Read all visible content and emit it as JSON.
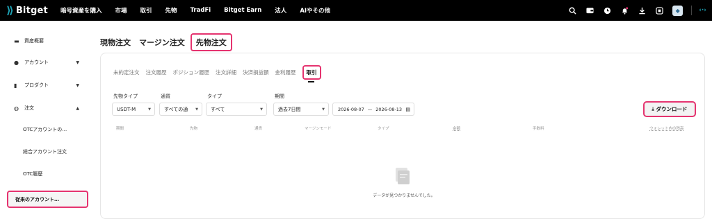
{
  "brand": {
    "name": "Bitget",
    "color": "#1da2b4"
  },
  "accent": "#e5336f",
  "nav": {
    "items": [
      "暗号資産を購入",
      "市場",
      "取引",
      "先物",
      "TradFi",
      "Bitget Earn",
      "法人",
      "AIやその他"
    ],
    "icons": [
      "search-icon",
      "wallet-icon",
      "history-icon",
      "bell-icon",
      "download-icon",
      "grid-icon",
      "avatar-icon",
      "signal-icon"
    ]
  },
  "sidebar": {
    "items": [
      {
        "icon": "folder-icon",
        "label": "資産概要"
      },
      {
        "icon": "person-icon",
        "label": "アカウント",
        "arrow": "▼"
      },
      {
        "icon": "chart-icon",
        "label": "プロダクト",
        "arrow": "▼"
      },
      {
        "icon": "orders-icon",
        "label": "注文",
        "arrow": "▲"
      }
    ],
    "sub_items": [
      "OTCアカウントの…",
      "総合アカウント注文",
      "OTC履歴"
    ],
    "active_item": "従来のアカウント…"
  },
  "top_tabs": [
    "現物注文",
    "マージン注文",
    "先物注文"
  ],
  "sub_tabs": [
    "未約定注文",
    "注文履歴",
    "ポジション履歴",
    "注文詳細",
    "決済損益額",
    "金利履歴",
    "取引"
  ],
  "filters": {
    "futures_type": {
      "label": "先物タイプ",
      "value": "USDT-M"
    },
    "currency": {
      "label": "通貨",
      "value": "すべての通"
    },
    "type": {
      "label": "タイプ",
      "value": "すべて"
    },
    "period": {
      "label": "期間",
      "value": "過去7日間"
    },
    "date_from": "2026-08-07",
    "date_sep": "—",
    "date_to": "2026-08-13"
  },
  "download_label": "ダウンロード",
  "columns": [
    "期間",
    "先物",
    "通貨",
    "マージンモード",
    "タイプ",
    "金額",
    "手数料",
    "ウォレット内の残高"
  ],
  "empty_text": "データが見つかりませんでした。"
}
